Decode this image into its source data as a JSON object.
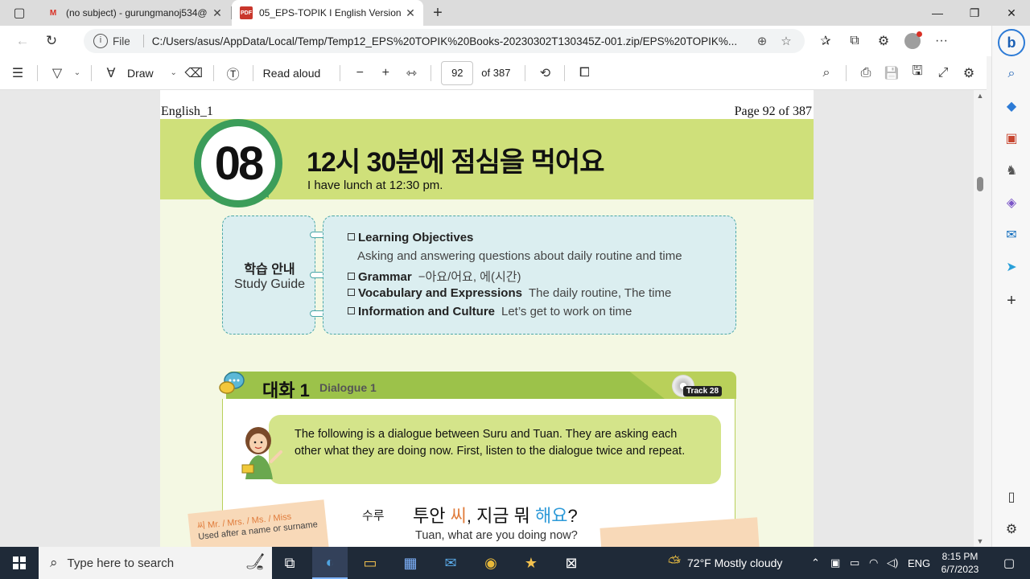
{
  "browser": {
    "tabs": [
      {
        "title": "(no subject) - gurungmanoj534@",
        "favicon": "gmail-icon",
        "active": false
      },
      {
        "title": "05_EPS-TOPIK I English Version L",
        "favicon": "pdf-icon",
        "active": true
      }
    ],
    "file_label": "File",
    "url": "C:/Users/asus/AppData/Local/Temp/Temp12_EPS%20TOPIK%20Books-20230302T130345Z-001.zip/EPS%20TOPIK%...",
    "pdf_badge": "PDF"
  },
  "pdf_toolbar": {
    "draw_label": "Draw",
    "read_aloud_label": "Read aloud",
    "page_current": "92",
    "page_total_label": "of 387"
  },
  "document": {
    "header_left": "English_1",
    "header_right": "Page 92 of 387",
    "lesson_number": "08",
    "lesson_title": "12시 30분에 점심을 먹어요",
    "lesson_subtitle": "I have lunch at 12:30 pm.",
    "study_guide_ko": "학습 안내",
    "study_guide_en": "Study Guide",
    "guide_items": [
      {
        "label": "Learning Objectives",
        "desc": ""
      },
      {
        "label": "",
        "desc": "Asking and answering questions about daily routine and time"
      },
      {
        "label": "Grammar",
        "desc": "−아요/어요, 에(시간)"
      },
      {
        "label": "Vocabulary and Expressions",
        "desc": "The daily routine, The time"
      },
      {
        "label": "Information and Culture",
        "desc": "Let’s get to work on time"
      }
    ],
    "dialogue_ko": "대화 1",
    "dialogue_en": "Dialogue 1",
    "track": "Track 28",
    "intro": "The following is a dialogue between Suru and Tuan. They are asking each other what they are doing now. First, listen to the dialogue twice and repeat.",
    "speaker": "수루",
    "line_ko_1": "투안 ",
    "line_ko_2": "씨",
    "line_ko_3": ", 지금 뭐 ",
    "line_ko_4": "해요",
    "line_ko_5": "?",
    "line_en": "Tuan, what are you doing now?",
    "note_title": "씨 Mr. / Mrs. / Ms. / Miss",
    "note_text": "Used after a name or surname"
  },
  "taskbar": {
    "search_placeholder": "Type here to search",
    "weather": "72°F  Mostly cloudy",
    "language": "ENG",
    "time": "8:15 PM",
    "date": "6/7/2023"
  }
}
